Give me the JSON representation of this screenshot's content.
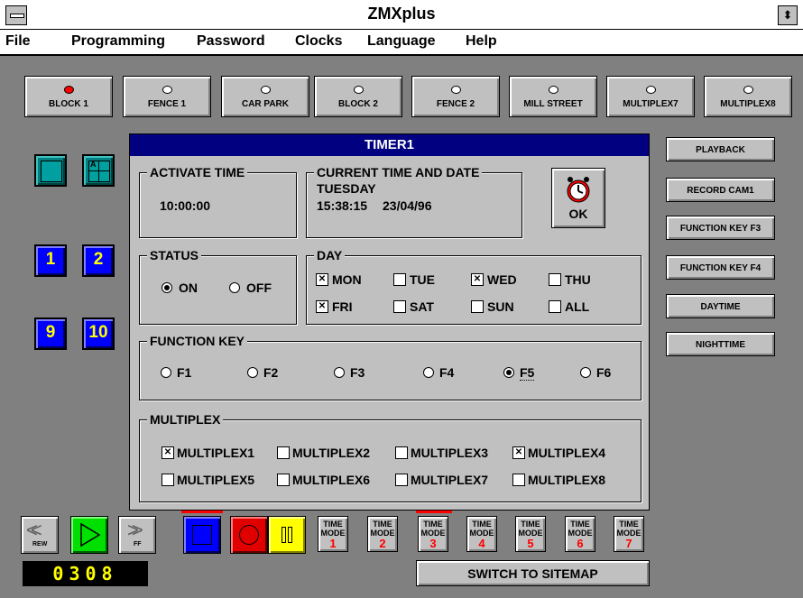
{
  "window": {
    "title": "ZMXplus"
  },
  "menu": [
    "File",
    "Programming",
    "Password",
    "Clocks",
    "Language",
    "Help"
  ],
  "zones": [
    {
      "label": "BLOCK 1",
      "active": true
    },
    {
      "label": "FENCE 1",
      "active": false
    },
    {
      "label": "CAR PARK",
      "active": false
    },
    {
      "label": "BLOCK 2",
      "active": false
    },
    {
      "label": "FENCE 2",
      "active": false
    },
    {
      "label": "MILL STREET",
      "active": false
    },
    {
      "label": "MULTIPLEX7",
      "active": false
    },
    {
      "label": "MULTIPLEX8",
      "active": false
    }
  ],
  "side_buttons": [
    "PLAYBACK",
    "RECORD CAM1",
    "FUNCTION KEY F3",
    "FUNCTION KEY F4",
    "DAYTIME",
    "NIGHTTIME"
  ],
  "cam_buttons": [
    "1",
    "2",
    "9",
    "10"
  ],
  "quad_tile_label": "A",
  "dialog": {
    "title": "TIMER1",
    "activate_time": {
      "label": "ACTIVATE TIME",
      "value": "10:00:00"
    },
    "current": {
      "label": "CURRENT TIME AND DATE",
      "day": "TUESDAY",
      "time": "15:38:15",
      "date": "23/04/96"
    },
    "ok_label": "OK",
    "status": {
      "label": "STATUS",
      "on": "ON",
      "off": "OFF",
      "selected": "ON"
    },
    "day": {
      "label": "DAY",
      "items": [
        {
          "label": "MON",
          "checked": true
        },
        {
          "label": "TUE",
          "checked": false
        },
        {
          "label": "WED",
          "checked": true
        },
        {
          "label": "THU",
          "checked": false
        },
        {
          "label": "FRI",
          "checked": true
        },
        {
          "label": "SAT",
          "checked": false
        },
        {
          "label": "SUN",
          "checked": false
        },
        {
          "label": "ALL",
          "checked": false
        }
      ]
    },
    "function_key": {
      "label": "FUNCTION KEY",
      "options": [
        "F1",
        "F2",
        "F3",
        "F4",
        "F5",
        "F6"
      ],
      "selected": "F5"
    },
    "multiplex": {
      "label": "MULTIPLEX",
      "items": [
        {
          "label": "MULTIPLEX1",
          "checked": true
        },
        {
          "label": "MULTIPLEX2",
          "checked": false
        },
        {
          "label": "MULTIPLEX3",
          "checked": false
        },
        {
          "label": "MULTIPLEX4",
          "checked": true
        },
        {
          "label": "MULTIPLEX5",
          "checked": false
        },
        {
          "label": "MULTIPLEX6",
          "checked": false
        },
        {
          "label": "MULTIPLEX7",
          "checked": false
        },
        {
          "label": "MULTIPLEX8",
          "checked": false
        }
      ]
    }
  },
  "transport": {
    "rew_label": "REW",
    "ff_label": "FF"
  },
  "time_modes": [
    {
      "label": "TIME MODE",
      "num": "1"
    },
    {
      "label": "TIME MODE",
      "num": "2"
    },
    {
      "label": "TIME MODE",
      "num": "3"
    },
    {
      "label": "TIME MODE",
      "num": "4"
    },
    {
      "label": "TIME MODE",
      "num": "5"
    },
    {
      "label": "TIME MODE",
      "num": "6"
    },
    {
      "label": "TIME MODE",
      "num": "7"
    }
  ],
  "counter": "0308",
  "sitemap_button": "SWITCH TO SITEMAP",
  "colors": {
    "dialog_title_bg": "#000080",
    "face": "#c0c0c0",
    "desktop": "#808080",
    "cam_blue": "#0000ff",
    "cam_text": "#ffff00",
    "led_red": "#ff0000"
  }
}
